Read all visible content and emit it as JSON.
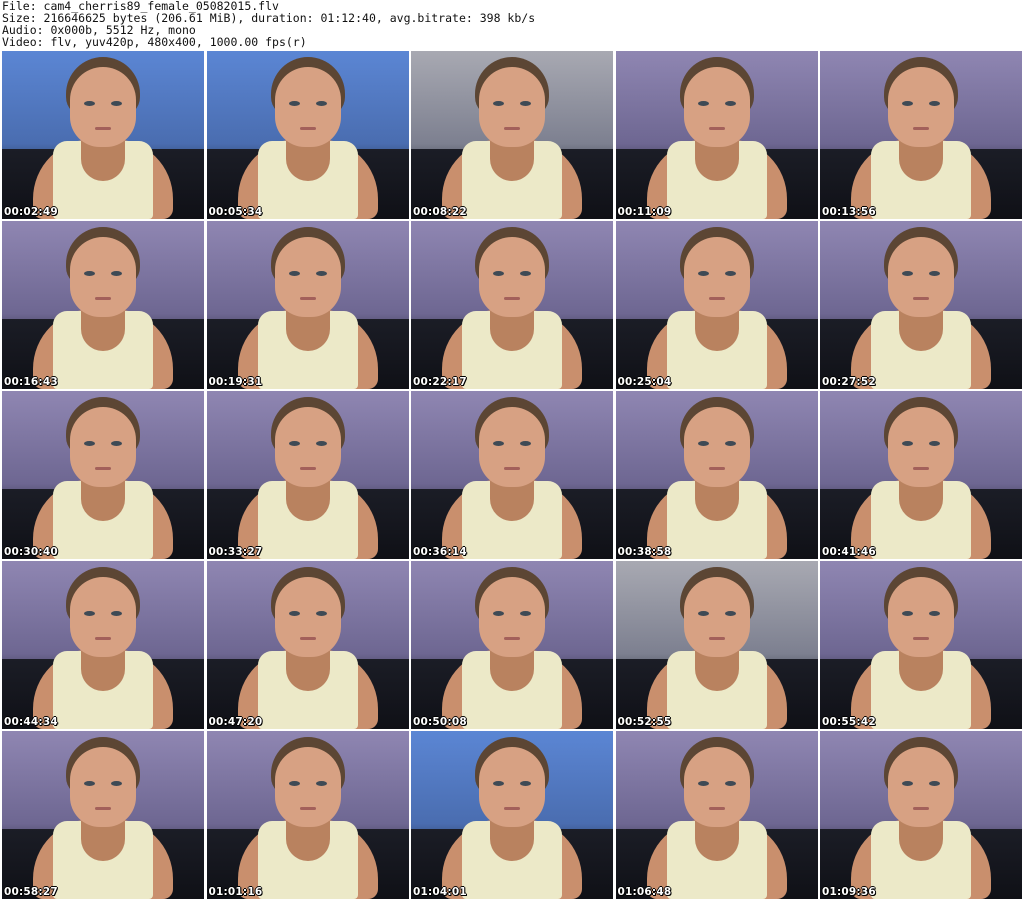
{
  "header": {
    "file_line": "File: cam4_cherris89_female_05082015.flv",
    "size_line": "Size: 216646625 bytes (206.61 MiB), duration: 01:12:40, avg.bitrate: 398 kb/s",
    "audio_line": "Audio: 0x000b, 5512 Hz, mono",
    "video_line": "Video: flv, yuv420p, 480x400, 1000.00 fps(r)"
  },
  "thumbnails": [
    {
      "time": "00:02:49",
      "tone": "blue"
    },
    {
      "time": "00:05:34",
      "tone": "blue"
    },
    {
      "time": "00:08:22",
      "tone": "grey"
    },
    {
      "time": "00:11:09",
      "tone": "purple"
    },
    {
      "time": "00:13:56",
      "tone": "purple"
    },
    {
      "time": "00:16:43",
      "tone": "purple"
    },
    {
      "time": "00:19:31",
      "tone": "purple"
    },
    {
      "time": "00:22:17",
      "tone": "purple"
    },
    {
      "time": "00:25:04",
      "tone": "purple"
    },
    {
      "time": "00:27:52",
      "tone": "purple"
    },
    {
      "time": "00:30:40",
      "tone": "purple"
    },
    {
      "time": "00:33:27",
      "tone": "purple"
    },
    {
      "time": "00:36:14",
      "tone": "purple"
    },
    {
      "time": "00:38:58",
      "tone": "purple"
    },
    {
      "time": "00:41:46",
      "tone": "purple"
    },
    {
      "time": "00:44:34",
      "tone": "purple"
    },
    {
      "time": "00:47:20",
      "tone": "purple"
    },
    {
      "time": "00:50:08",
      "tone": "purple"
    },
    {
      "time": "00:52:55",
      "tone": "grey"
    },
    {
      "time": "00:55:42",
      "tone": "purple"
    },
    {
      "time": "00:58:27",
      "tone": "purple"
    },
    {
      "time": "01:01:16",
      "tone": "purple"
    },
    {
      "time": "01:04:01",
      "tone": "blue"
    },
    {
      "time": "01:06:48",
      "tone": "purple"
    },
    {
      "time": "01:09:36",
      "tone": "purple"
    }
  ]
}
